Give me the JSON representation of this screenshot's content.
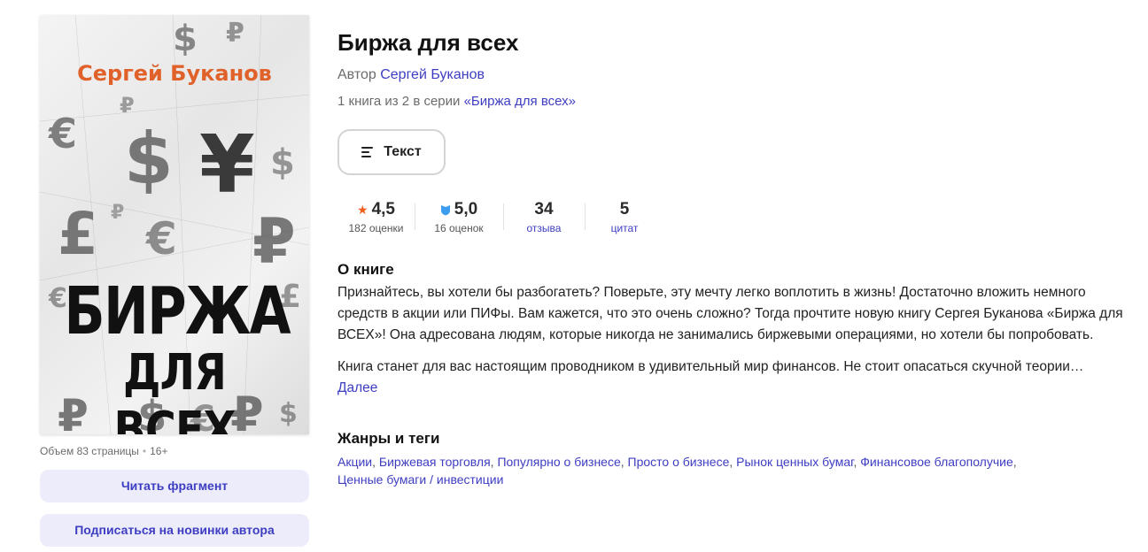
{
  "cover": {
    "author_text": "Сергей Буканов",
    "title_line1": "БИРЖА",
    "title_line2": "ДЛЯ ВСЕХ"
  },
  "meta": {
    "volume": "Объем 83 страницы",
    "separator": "•",
    "age": "16+"
  },
  "side_buttons": {
    "read_fragment": "Читать фрагмент",
    "subscribe": "Подписаться на новинки автора"
  },
  "book": {
    "title": "Биржа для всех",
    "author_prefix": "Автор",
    "author": "Сергей Буканов",
    "series_prefix": "1 книга из 2 в серии",
    "series": "«Биржа для всех»"
  },
  "format_button": {
    "label": "Текст"
  },
  "stats": {
    "rating": "4,5",
    "rating_count": "182 оценки",
    "lb_rating": "5,0",
    "lb_count": "16 оценок",
    "reviews": "34",
    "reviews_label": "отзыва",
    "quotes": "5",
    "quotes_label": "цитат"
  },
  "about": {
    "title": "О книге",
    "para1": "Признайтесь, вы хотели бы разбогатеть? Поверьте, эту мечту легко воплотить в жизнь! Достаточно вложить немного средств в акции или ПИФы. Вам кажется, что это очень сложно? Тогда прочтите новую книгу Сергея Буканова «Биржа для ВСЕХ»! Она адресована людям, которые никогда не занимались биржевыми операциями, но хотели бы попробовать.",
    "para2": "Книга станет для вас настоящим проводником в удивительный мир финансов. Не стоит опасаться скучной теории…",
    "more": "Далее"
  },
  "genres": {
    "title": "Жанры и теги",
    "tags": [
      "Акции",
      "Биржевая торговля",
      "Популярно о бизнесе",
      "Просто о бизнесе",
      "Рынок ценных бумаг",
      "Финансовое благополучие",
      "Ценные бумаги / инвестиции"
    ],
    "separator": ","
  },
  "colors": {
    "accent": "#3d3dc2",
    "star": "#f25c1d",
    "shield": "#3b9cf0",
    "button_bg": "#ececfb",
    "cover_author": "#e0622a"
  }
}
